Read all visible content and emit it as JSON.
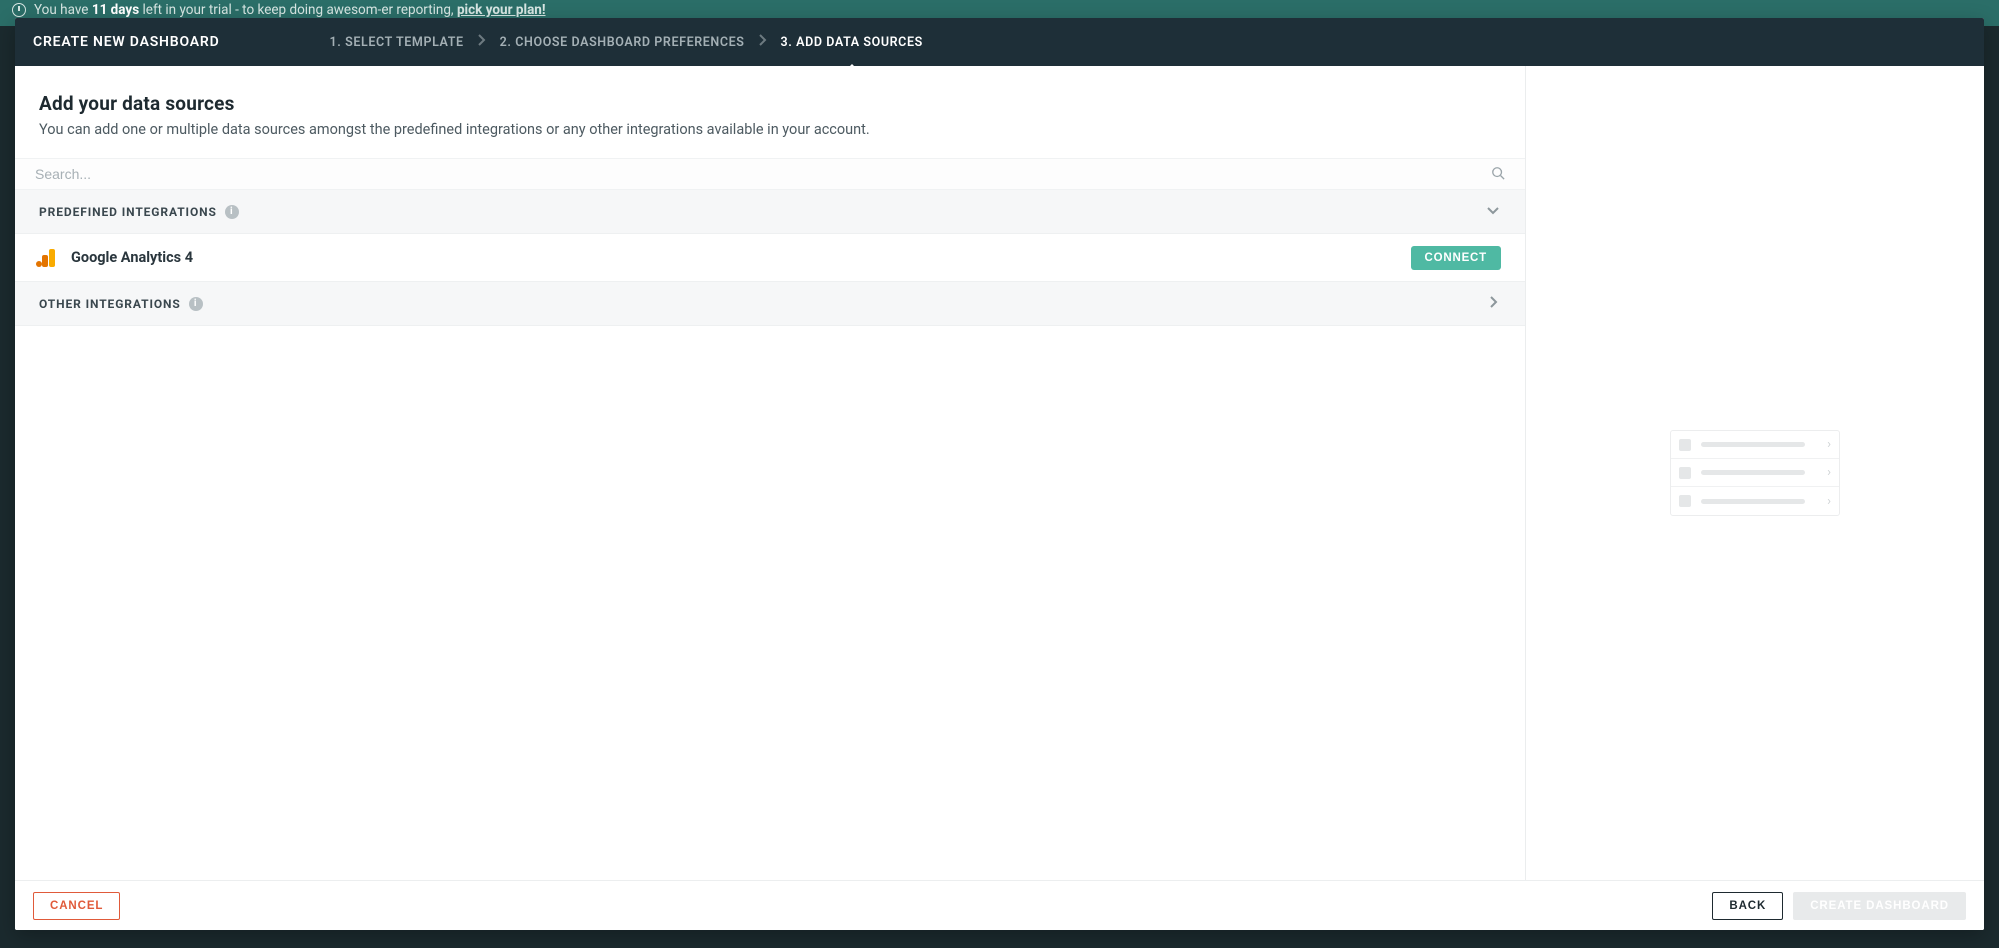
{
  "trial": {
    "prefix": "You have",
    "days": "11 days",
    "middle": "left in your trial - to keep doing awesom-er reporting,",
    "link": "pick your plan!"
  },
  "wizard": {
    "title": "CREATE NEW DASHBOARD",
    "steps": {
      "s1": "1. SELECT TEMPLATE",
      "s2": "2. CHOOSE DASHBOARD PREFERENCES",
      "s3": "3. ADD DATA SOURCES"
    }
  },
  "intro": {
    "heading": "Add your data sources",
    "sub": "You can add one or multiple data sources amongst the predefined integrations or any other integrations available in your account."
  },
  "search": {
    "placeholder": "Search..."
  },
  "sections": {
    "predefined": "PREDEFINED INTEGRATIONS",
    "other": "OTHER INTEGRATIONS"
  },
  "integrations": {
    "ga4": {
      "name": "Google Analytics 4",
      "connect": "CONNECT"
    }
  },
  "footer": {
    "cancel": "CANCEL",
    "back": "BACK",
    "create": "CREATE DASHBOARD"
  }
}
